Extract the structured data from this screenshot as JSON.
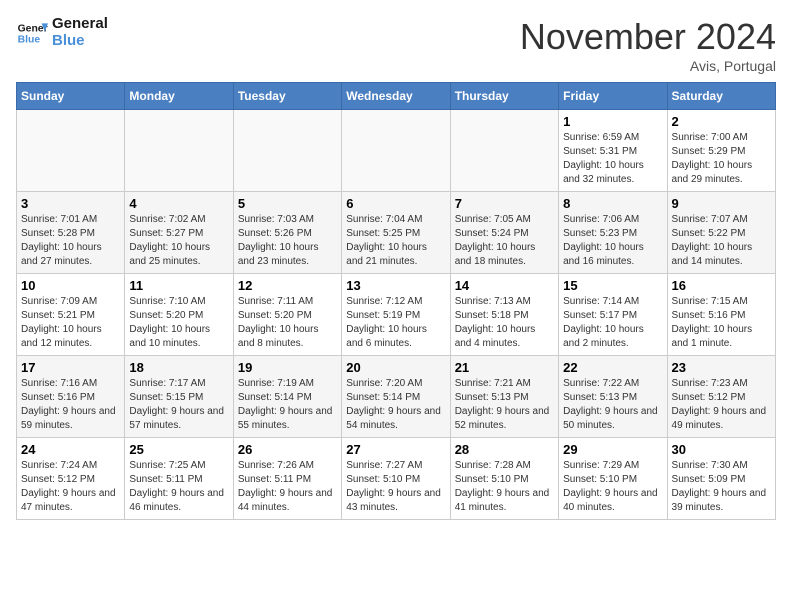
{
  "header": {
    "logo_line1": "General",
    "logo_line2": "Blue",
    "month": "November 2024",
    "location": "Avis, Portugal"
  },
  "weekdays": [
    "Sunday",
    "Monday",
    "Tuesday",
    "Wednesday",
    "Thursday",
    "Friday",
    "Saturday"
  ],
  "weeks": [
    [
      {
        "day": "",
        "empty": true
      },
      {
        "day": "",
        "empty": true
      },
      {
        "day": "",
        "empty": true
      },
      {
        "day": "",
        "empty": true
      },
      {
        "day": "",
        "empty": true
      },
      {
        "day": "1",
        "sunrise": "6:59 AM",
        "sunset": "5:31 PM",
        "daylight": "10 hours and 32 minutes."
      },
      {
        "day": "2",
        "sunrise": "7:00 AM",
        "sunset": "5:29 PM",
        "daylight": "10 hours and 29 minutes."
      }
    ],
    [
      {
        "day": "3",
        "sunrise": "7:01 AM",
        "sunset": "5:28 PM",
        "daylight": "10 hours and 27 minutes."
      },
      {
        "day": "4",
        "sunrise": "7:02 AM",
        "sunset": "5:27 PM",
        "daylight": "10 hours and 25 minutes."
      },
      {
        "day": "5",
        "sunrise": "7:03 AM",
        "sunset": "5:26 PM",
        "daylight": "10 hours and 23 minutes."
      },
      {
        "day": "6",
        "sunrise": "7:04 AM",
        "sunset": "5:25 PM",
        "daylight": "10 hours and 21 minutes."
      },
      {
        "day": "7",
        "sunrise": "7:05 AM",
        "sunset": "5:24 PM",
        "daylight": "10 hours and 18 minutes."
      },
      {
        "day": "8",
        "sunrise": "7:06 AM",
        "sunset": "5:23 PM",
        "daylight": "10 hours and 16 minutes."
      },
      {
        "day": "9",
        "sunrise": "7:07 AM",
        "sunset": "5:22 PM",
        "daylight": "10 hours and 14 minutes."
      }
    ],
    [
      {
        "day": "10",
        "sunrise": "7:09 AM",
        "sunset": "5:21 PM",
        "daylight": "10 hours and 12 minutes."
      },
      {
        "day": "11",
        "sunrise": "7:10 AM",
        "sunset": "5:20 PM",
        "daylight": "10 hours and 10 minutes."
      },
      {
        "day": "12",
        "sunrise": "7:11 AM",
        "sunset": "5:20 PM",
        "daylight": "10 hours and 8 minutes."
      },
      {
        "day": "13",
        "sunrise": "7:12 AM",
        "sunset": "5:19 PM",
        "daylight": "10 hours and 6 minutes."
      },
      {
        "day": "14",
        "sunrise": "7:13 AM",
        "sunset": "5:18 PM",
        "daylight": "10 hours and 4 minutes."
      },
      {
        "day": "15",
        "sunrise": "7:14 AM",
        "sunset": "5:17 PM",
        "daylight": "10 hours and 2 minutes."
      },
      {
        "day": "16",
        "sunrise": "7:15 AM",
        "sunset": "5:16 PM",
        "daylight": "10 hours and 1 minute."
      }
    ],
    [
      {
        "day": "17",
        "sunrise": "7:16 AM",
        "sunset": "5:16 PM",
        "daylight": "9 hours and 59 minutes."
      },
      {
        "day": "18",
        "sunrise": "7:17 AM",
        "sunset": "5:15 PM",
        "daylight": "9 hours and 57 minutes."
      },
      {
        "day": "19",
        "sunrise": "7:19 AM",
        "sunset": "5:14 PM",
        "daylight": "9 hours and 55 minutes."
      },
      {
        "day": "20",
        "sunrise": "7:20 AM",
        "sunset": "5:14 PM",
        "daylight": "9 hours and 54 minutes."
      },
      {
        "day": "21",
        "sunrise": "7:21 AM",
        "sunset": "5:13 PM",
        "daylight": "9 hours and 52 minutes."
      },
      {
        "day": "22",
        "sunrise": "7:22 AM",
        "sunset": "5:13 PM",
        "daylight": "9 hours and 50 minutes."
      },
      {
        "day": "23",
        "sunrise": "7:23 AM",
        "sunset": "5:12 PM",
        "daylight": "9 hours and 49 minutes."
      }
    ],
    [
      {
        "day": "24",
        "sunrise": "7:24 AM",
        "sunset": "5:12 PM",
        "daylight": "9 hours and 47 minutes."
      },
      {
        "day": "25",
        "sunrise": "7:25 AM",
        "sunset": "5:11 PM",
        "daylight": "9 hours and 46 minutes."
      },
      {
        "day": "26",
        "sunrise": "7:26 AM",
        "sunset": "5:11 PM",
        "daylight": "9 hours and 44 minutes."
      },
      {
        "day": "27",
        "sunrise": "7:27 AM",
        "sunset": "5:10 PM",
        "daylight": "9 hours and 43 minutes."
      },
      {
        "day": "28",
        "sunrise": "7:28 AM",
        "sunset": "5:10 PM",
        "daylight": "9 hours and 41 minutes."
      },
      {
        "day": "29",
        "sunrise": "7:29 AM",
        "sunset": "5:10 PM",
        "daylight": "9 hours and 40 minutes."
      },
      {
        "day": "30",
        "sunrise": "7:30 AM",
        "sunset": "5:09 PM",
        "daylight": "9 hours and 39 minutes."
      }
    ]
  ],
  "labels": {
    "sunrise": "Sunrise:",
    "sunset": "Sunset:",
    "daylight": "Daylight:"
  }
}
